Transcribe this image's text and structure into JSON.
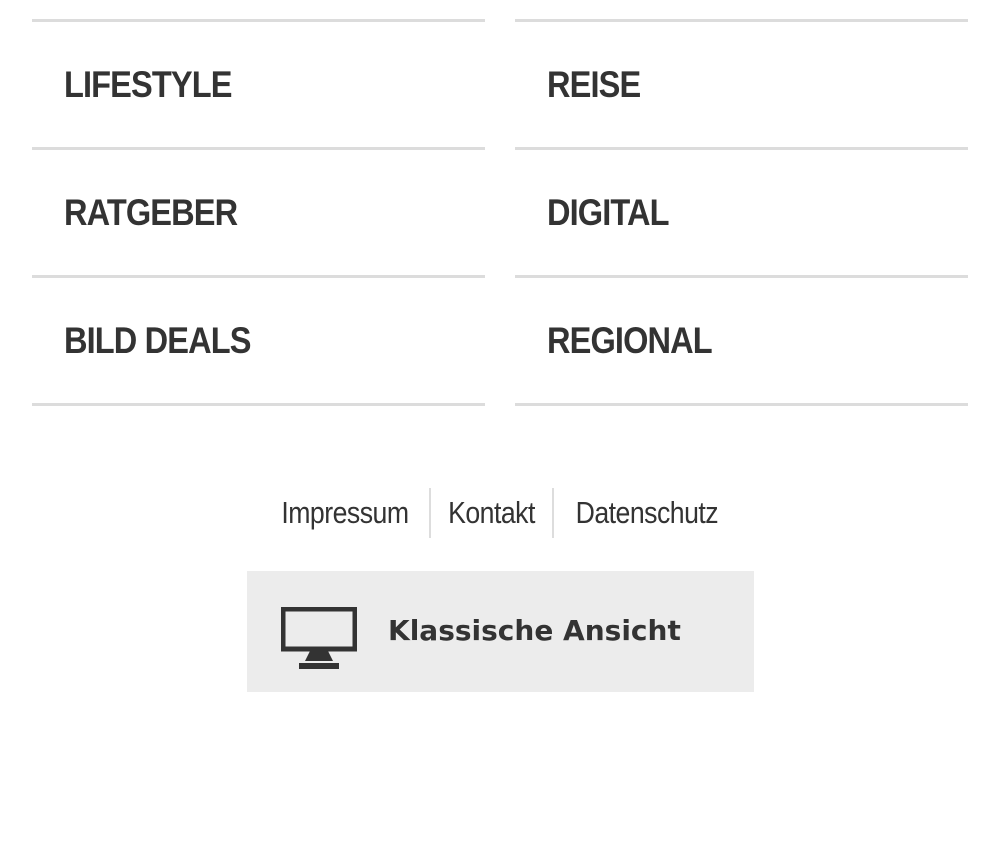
{
  "nav": {
    "items": [
      {
        "label": "LIFESTYLE"
      },
      {
        "label": "REISE"
      },
      {
        "label": "RATGEBER"
      },
      {
        "label": "DIGITAL"
      },
      {
        "label": "BILD DEALS"
      },
      {
        "label": "REGIONAL"
      }
    ]
  },
  "footer": {
    "links": [
      {
        "label": "Impressum"
      },
      {
        "label": "Kontakt"
      },
      {
        "label": "Datenschutz"
      }
    ]
  },
  "classic_view": {
    "label": "Klassische Ansicht",
    "icon": "desktop-monitor-icon"
  },
  "colors": {
    "text": "#333333",
    "divider": "#dcdcdc",
    "button_bg": "#ececec"
  }
}
